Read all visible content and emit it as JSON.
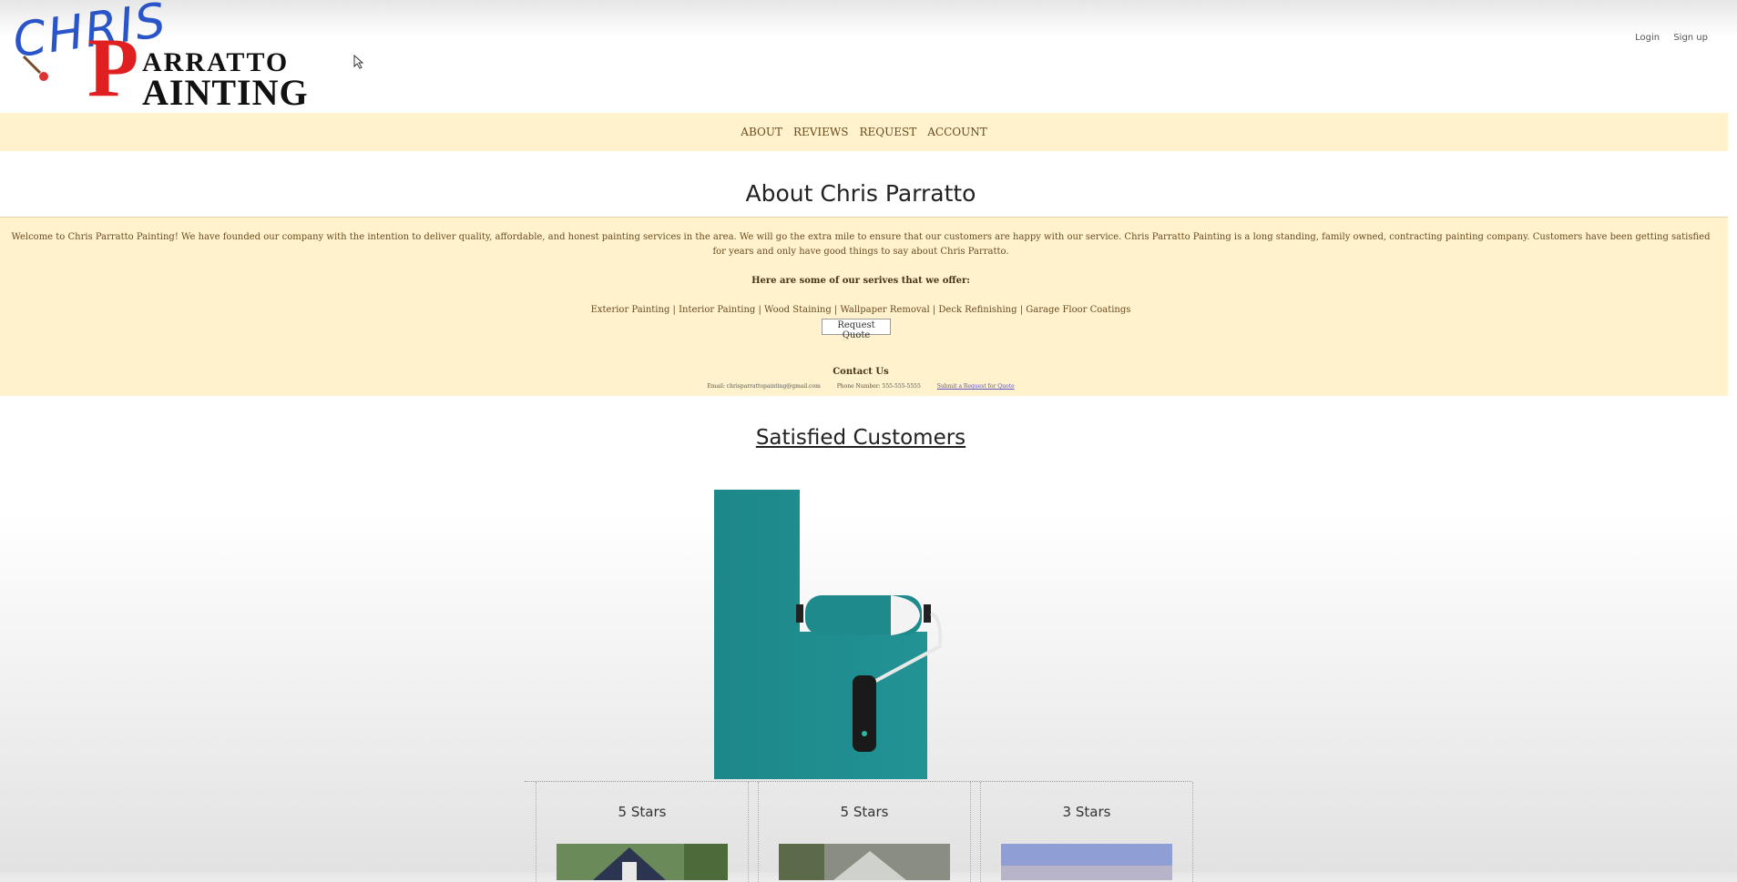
{
  "logo": {
    "script": "CHRIS",
    "initial": "P",
    "top": "ARRATTO",
    "bottom": "AINTING"
  },
  "auth": {
    "login": "Login",
    "signup": "Sign up"
  },
  "nav": {
    "items": [
      "ABOUT",
      "REVIEWS",
      "REQUEST",
      "ACCOUNT"
    ]
  },
  "about": {
    "title": "About Chris Parratto",
    "text": "Welcome to Chris Parratto Painting! We have founded our company with the intention to deliver quality, affordable, and honest painting services in the area. We will go the extra mile to ensure that our customers are happy with our service. Chris Parratto Painting is a long standing, family owned, contracting painting company. Customers have been getting satisfied for years and only have good things to say about Chris Parratto.",
    "services_heading": "Here are some of our serives that we offer:",
    "services": "Exterior Painting | Interior Painting | Wood Staining | Wallpaper Removal | Deck Refinishing | Garage Floor Coatings",
    "quote_button": "Request Quote",
    "contact_heading": "Contact Us",
    "email": "Email: chrisparrattopainting@gmail.com",
    "phone": "Phone Number: 555-555-5555",
    "link": "Submit a Request for Quote"
  },
  "satisfied": {
    "title": "Satisfied Customers"
  },
  "reviews": [
    {
      "stars": "5 Stars"
    },
    {
      "stars": "5 Stars"
    },
    {
      "stars": "3 Stars"
    }
  ],
  "colors": {
    "nav_bg": "#fff2cc",
    "brand_red": "#e02020",
    "teal": "#1f8c8e",
    "script_blue": "#2a55c8"
  }
}
